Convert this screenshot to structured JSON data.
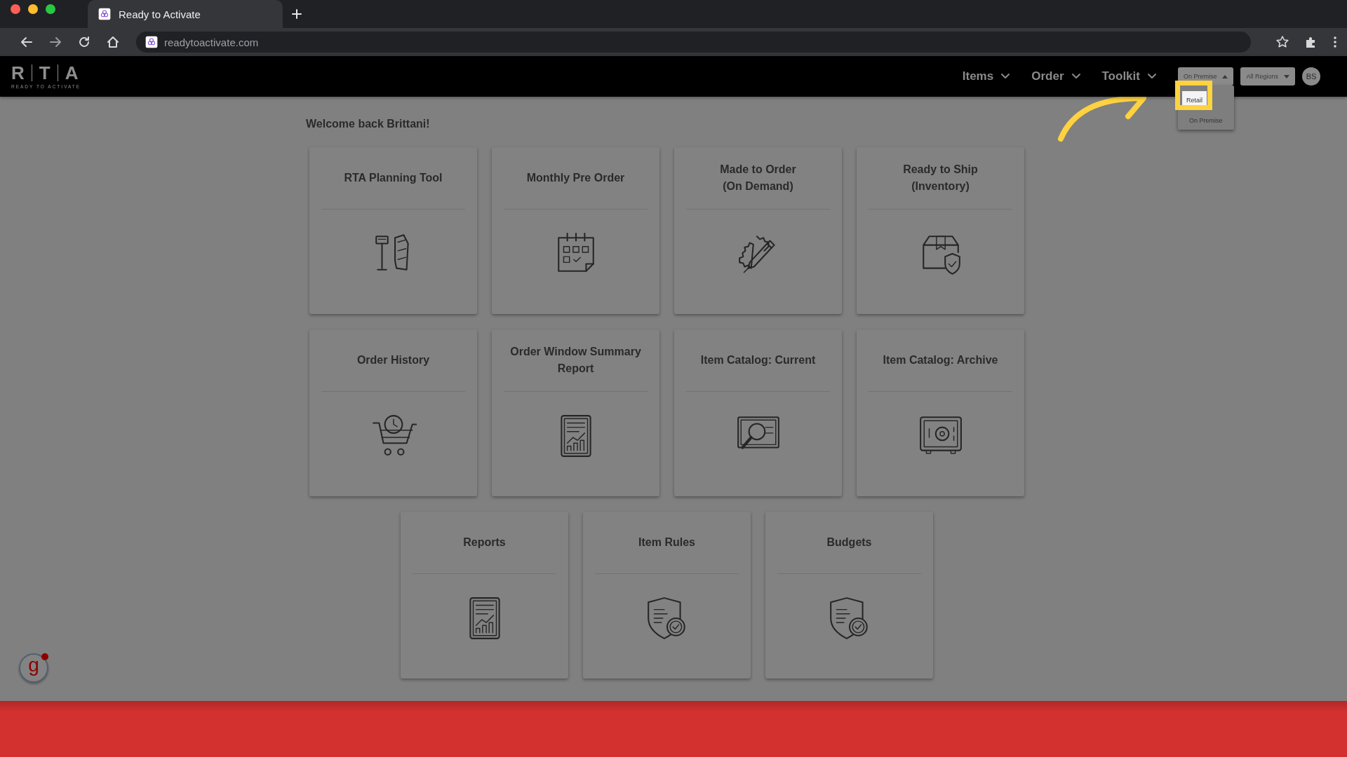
{
  "browser": {
    "tab_title": "Ready to Activate",
    "url": "readytoactivate.com"
  },
  "header": {
    "logo": {
      "letters": [
        "R",
        "T",
        "A"
      ],
      "tagline": "READY TO ACTIVATE"
    },
    "nav": [
      {
        "label": "Items"
      },
      {
        "label": "Order"
      },
      {
        "label": "Toolkit"
      }
    ],
    "scope_button": {
      "label": "On Premise",
      "expanded": true
    },
    "region_button": {
      "label": "All Regions"
    },
    "avatar": "BS",
    "scope_menu": [
      {
        "label": "Retail",
        "selected": true
      },
      {
        "label": "On Premise",
        "selected": false
      }
    ]
  },
  "welcome": "Welcome back Brittani!",
  "tiles": [
    [
      {
        "lines": [
          "RTA Planning Tool"
        ]
      },
      {
        "lines": [
          "Monthly Pre Order"
        ]
      },
      {
        "lines": [
          "Made to Order",
          "(On Demand)"
        ]
      },
      {
        "lines": [
          "Ready to Ship",
          "(Inventory)"
        ]
      }
    ],
    [
      {
        "lines": [
          "Order History"
        ]
      },
      {
        "lines": [
          "Order Window Summary",
          "Report"
        ]
      },
      {
        "lines": [
          "Item Catalog: Current"
        ]
      },
      {
        "lines": [
          "Item Catalog: Archive"
        ]
      }
    ],
    [
      {
        "lines": [
          "Reports"
        ]
      },
      {
        "lines": [
          "Item Rules"
        ]
      },
      {
        "lines": [
          "Budgets"
        ]
      }
    ]
  ],
  "widget": {
    "label": "g"
  }
}
